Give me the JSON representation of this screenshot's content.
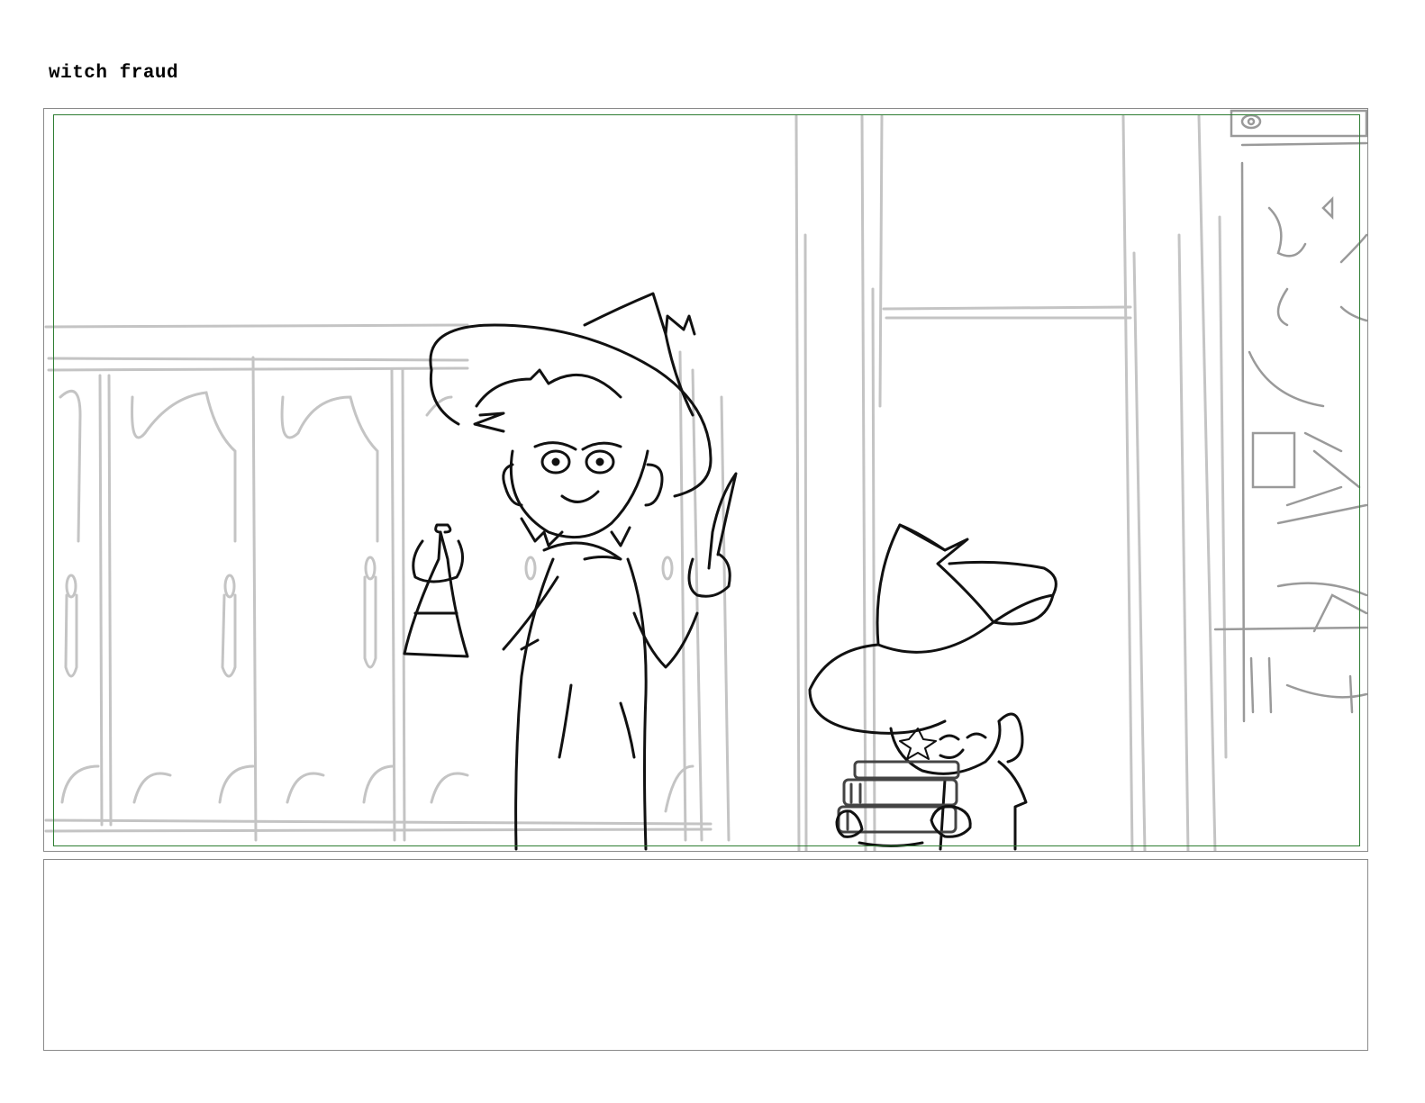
{
  "board": {
    "title": "witch fraud",
    "notes": ""
  },
  "colors": {
    "safe_frame": "#2e7d32",
    "background_sketch": "#c4c4c4",
    "character_ink": "#111111"
  }
}
